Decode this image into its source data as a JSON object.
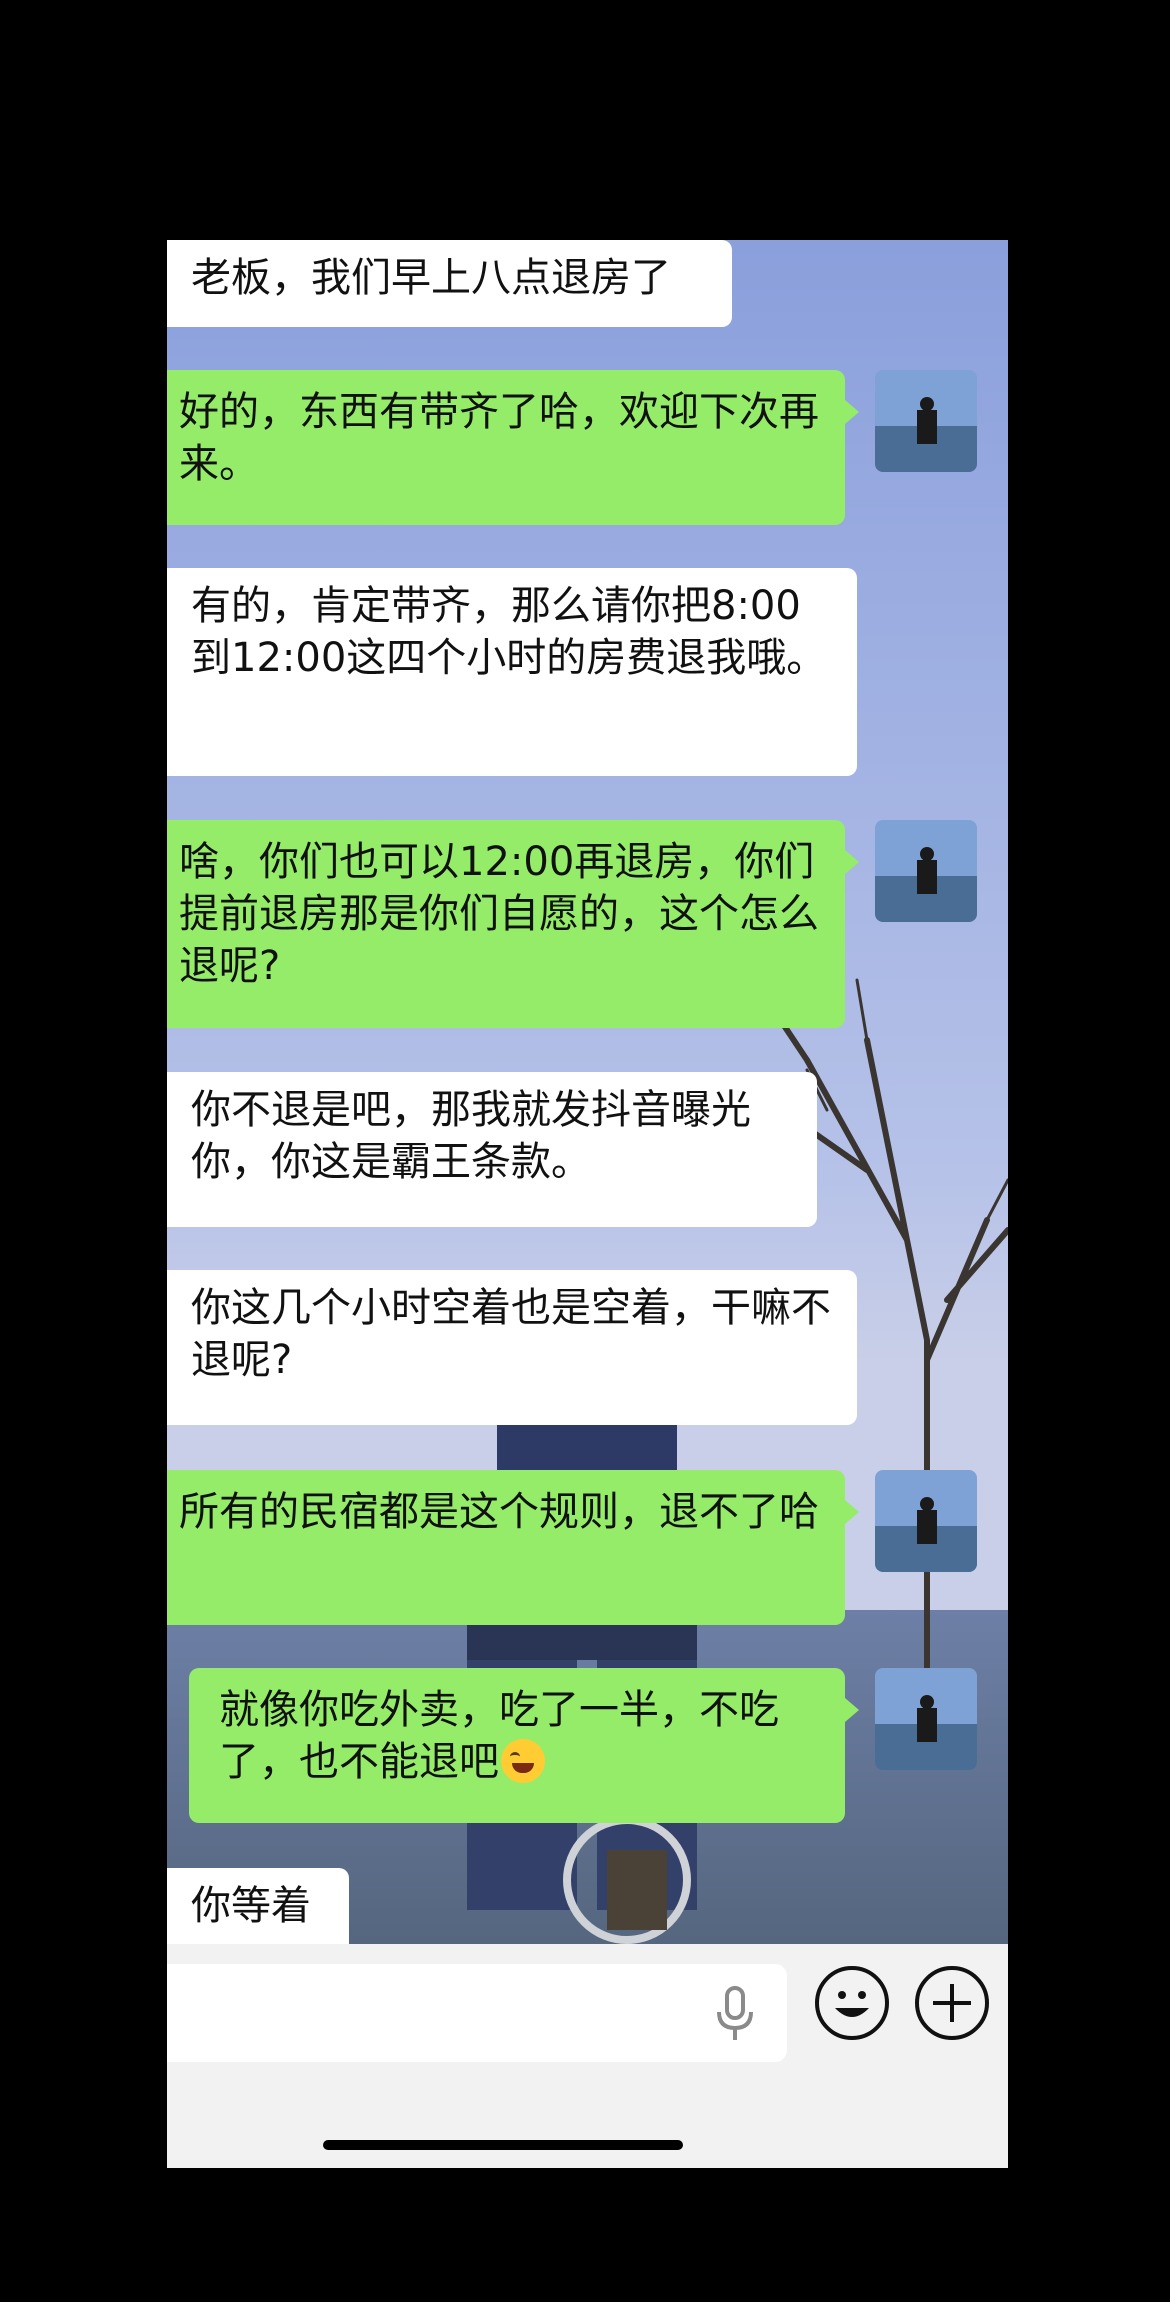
{
  "messages": [
    {
      "side": "received",
      "text": "老板，我们早上八点退房了"
    },
    {
      "side": "sent",
      "text": "好的，东西有带齐了哈，欢迎下次再来。"
    },
    {
      "side": "received",
      "text": "有的，肯定带齐，那么请你把8:00到12:00这四个小时的房费退我哦。"
    },
    {
      "side": "sent",
      "text": "啥，你们也可以12:00再退房，你们提前退房那是你们自愿的，这个怎么退呢?"
    },
    {
      "side": "received",
      "text": "你不退是吧，那我就发抖音曝光你，你这是霸王条款。"
    },
    {
      "side": "received",
      "text": "你这几个小时空着也是空着，干嘛不退呢?"
    },
    {
      "side": "sent",
      "text": "所有的民宿都是这个规则，退不了哈"
    },
    {
      "side": "sent",
      "text": "就像你吃外卖，吃了一半，不吃了，也不能退吧",
      "emoji": "tears-of-joy-emoji"
    },
    {
      "side": "received",
      "text": "你等着"
    }
  ],
  "input_bar": {
    "text_field_value": "",
    "icons": [
      "microphone-icon",
      "emoji-icon",
      "plus-icon"
    ]
  },
  "colors": {
    "sent_bubble": "#95ec69",
    "received_bubble": "#ffffff",
    "input_bar": "#f2f2f2"
  }
}
